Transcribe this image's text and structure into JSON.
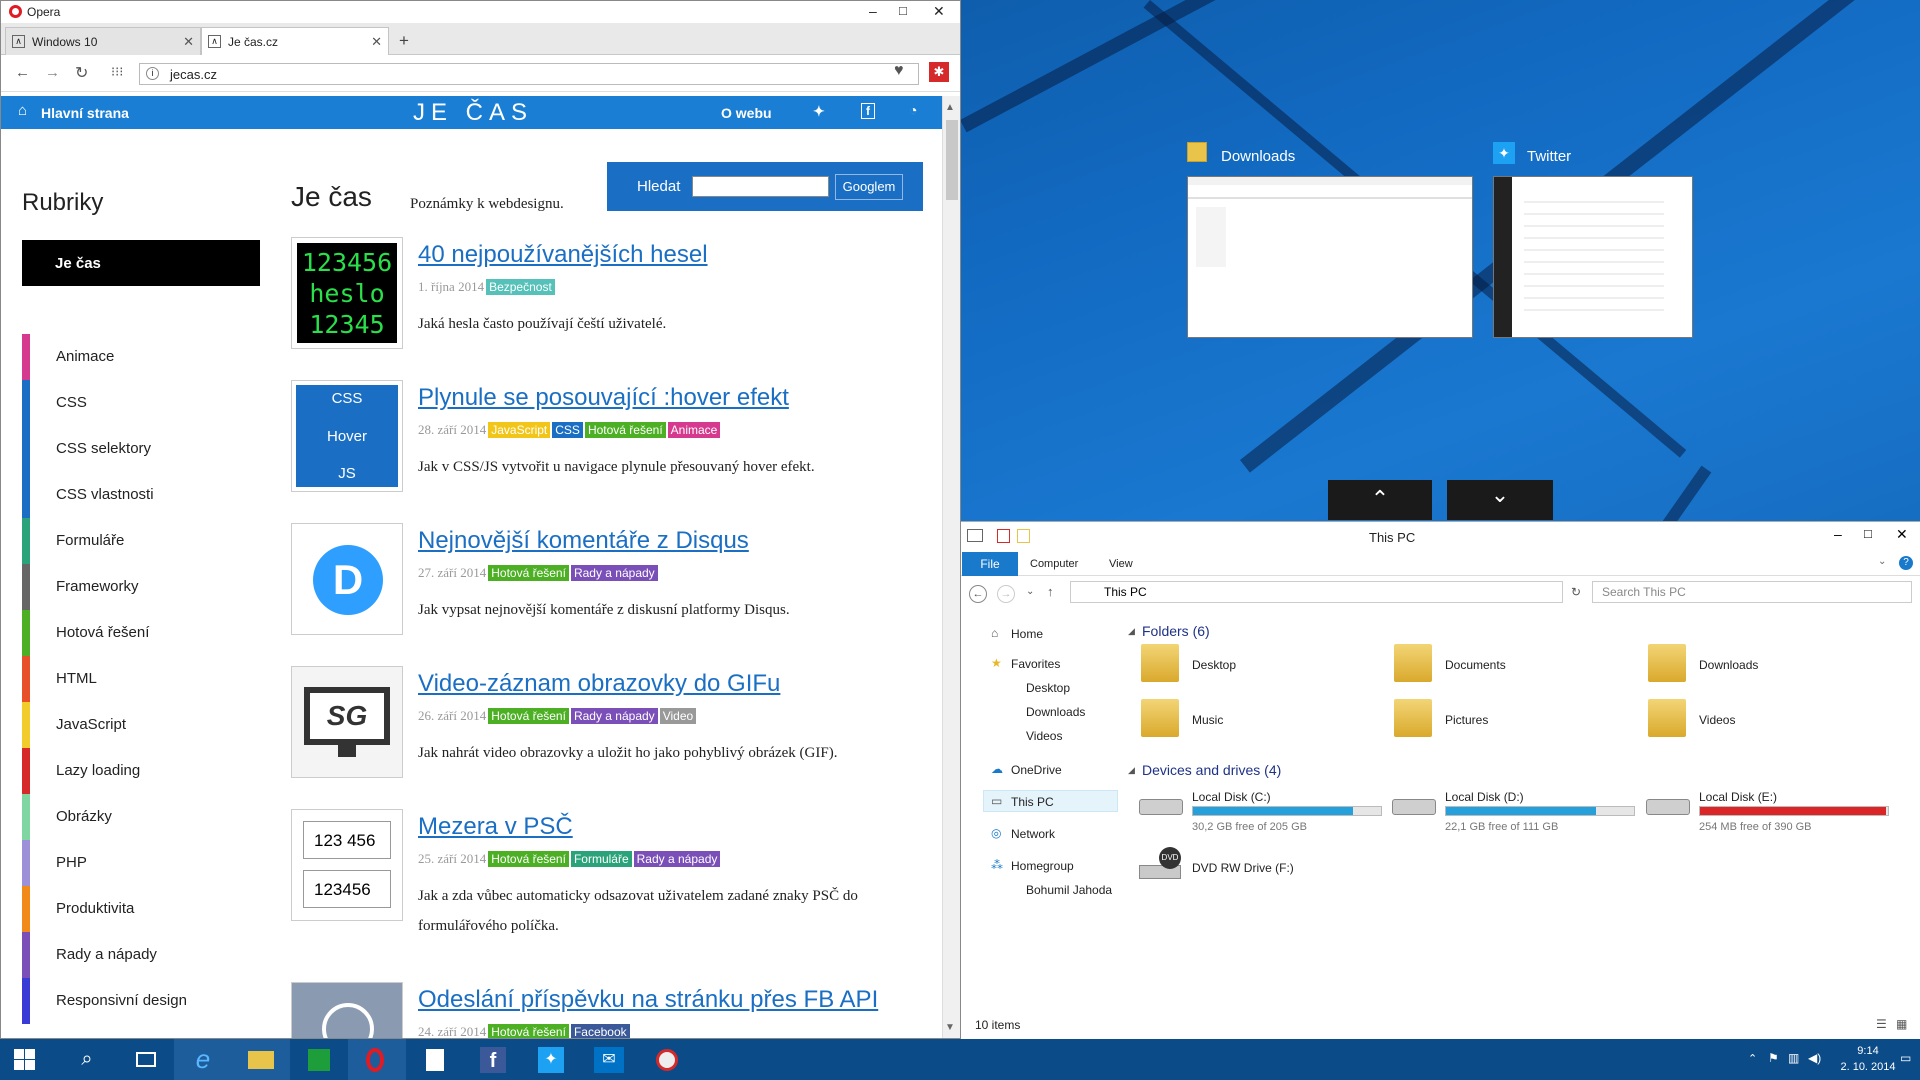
{
  "opera": {
    "title": "Opera",
    "tabs": [
      {
        "label": "Windows 10"
      },
      {
        "label": "Je čas.cz"
      }
    ],
    "url": "jecas.cz"
  },
  "site": {
    "nav_home": "Hlavní strana",
    "logo": "JE ČAS",
    "nav_about": "O webu",
    "heading": "Je čas",
    "tagline": "Poznámky k webdesignu.",
    "search_label": "Hledat",
    "search_button": "Googlem",
    "rubriky": "Rubriky",
    "active_cat": "Je čas",
    "categories": [
      {
        "label": "Animace",
        "color": "#d63a8f"
      },
      {
        "label": "CSS",
        "color": "#1a6fc4"
      },
      {
        "label": "CSS selektory",
        "color": "#1a6fc4"
      },
      {
        "label": "CSS vlastnosti",
        "color": "#1a6fc4"
      },
      {
        "label": "Formuláře",
        "color": "#2aa37a"
      },
      {
        "label": "Frameworky",
        "color": "#666666"
      },
      {
        "label": "Hotová řešení",
        "color": "#4caf24"
      },
      {
        "label": "HTML",
        "color": "#e8502a"
      },
      {
        "label": "JavaScript",
        "color": "#f2cc2a"
      },
      {
        "label": "Lazy loading",
        "color": "#d62a2a"
      },
      {
        "label": "Obrázky",
        "color": "#7fd6a0"
      },
      {
        "label": "PHP",
        "color": "#9c90d8"
      },
      {
        "label": "Produktivita",
        "color": "#f28a1a"
      },
      {
        "label": "Rady a nápady",
        "color": "#7a4fb8"
      },
      {
        "label": "Responsivní design",
        "color": "#3a3ad6"
      }
    ],
    "articles": [
      {
        "title": "40 nejpoužívanějších hesel",
        "date": "1. října 2014",
        "tags": [
          {
            "label": "Bezpečnost",
            "color": "#55c1b8"
          }
        ],
        "desc": "Jaká hesla často používají čeští uživatelé.",
        "thumb": {
          "lines": [
            "123456",
            "heslo",
            "12345"
          ]
        }
      },
      {
        "title": "Plynule se posouvající :hover efekt",
        "date": "28. září 2014",
        "tags": [
          {
            "label": "JavaScript",
            "color": "#f2c619"
          },
          {
            "label": "CSS",
            "color": "#1a6fc4"
          },
          {
            "label": "Hotová řešení",
            "color": "#4caf24"
          },
          {
            "label": "Animace",
            "color": "#d63a8f"
          }
        ],
        "desc": "Jak v CSS/JS vytvořit u navigace plynule přesouvaný hover efekt.",
        "thumb": {
          "lines": [
            "CSS",
            "Hover",
            "JS"
          ]
        }
      },
      {
        "title": "Nejnovější komentáře z Disqus",
        "date": "27. září 2014",
        "tags": [
          {
            "label": "Hotová řešení",
            "color": "#4caf24"
          },
          {
            "label": "Rady a nápady",
            "color": "#7a4fb8"
          }
        ],
        "desc": "Jak vypsat nejnovější komentáře z diskusní platformy Disqus.",
        "thumb": {
          "lines": [
            "D"
          ]
        }
      },
      {
        "title": "Video-záznam obrazovky do GIFu",
        "date": "26. září 2014",
        "tags": [
          {
            "label": "Hotová řešení",
            "color": "#4caf24"
          },
          {
            "label": "Rady a nápady",
            "color": "#7a4fb8"
          },
          {
            "label": "Video",
            "color": "#999999"
          }
        ],
        "desc": "Jak nahrát video obrazovky a uložit ho jako pohyblivý obrázek (GIF).",
        "thumb": {
          "lines": [
            "SG"
          ]
        }
      },
      {
        "title": "Mezera v PSČ",
        "date": "25. září 2014",
        "tags": [
          {
            "label": "Hotová řešení",
            "color": "#4caf24"
          },
          {
            "label": "Formuláře",
            "color": "#2aa37a"
          },
          {
            "label": "Rady a nápady",
            "color": "#7a4fb8"
          }
        ],
        "desc": "Jak a zda vůbec automaticky odsazovat uživatelem zadané znaky PSČ do formulářového políčka.",
        "thumb": {
          "lines": [
            "123 456",
            "123456"
          ]
        }
      },
      {
        "title": "Odeslání příspěvku na stránku přes FB API",
        "date": "24. září 2014",
        "tags": [
          {
            "label": "Hotová řešení",
            "color": "#4caf24"
          },
          {
            "label": "Facebook",
            "color": "#3b5998"
          }
        ],
        "desc": "",
        "thumb": {
          "lines": []
        }
      }
    ]
  },
  "taskview": {
    "windows": [
      {
        "label": "Downloads"
      },
      {
        "label": "Twitter"
      }
    ]
  },
  "explorer": {
    "title": "This PC",
    "ribbon_tabs": [
      "File",
      "Computer",
      "View"
    ],
    "address": "This PC",
    "search_placeholder": "Search This PC",
    "nav": {
      "home": "Home",
      "favorites": "Favorites",
      "desktop": "Desktop",
      "downloads": "Downloads",
      "videos": "Videos",
      "onedrive": "OneDrive",
      "thispc": "This PC",
      "network": "Network",
      "homegroup": "Homegroup",
      "user": "Bohumil Jahoda"
    },
    "folders_header": "Folders (6)",
    "folders": [
      "Desktop",
      "Documents",
      "Downloads",
      "Music",
      "Pictures",
      "Videos"
    ],
    "drives_header": "Devices and drives (4)",
    "drives": [
      {
        "name": "Local Disk (C:)",
        "free": "30,2 GB free of 205 GB",
        "used": 0.85,
        "color": "#26a0da"
      },
      {
        "name": "Local Disk (D:)",
        "free": "22,1 GB free of 111 GB",
        "used": 0.8,
        "color": "#26a0da"
      },
      {
        "name": "Local Disk (E:)",
        "free": "254 MB free of 390 GB",
        "used": 0.99,
        "color": "#da2626"
      }
    ],
    "dvd": "DVD RW Drive (F:)",
    "status": "10 items"
  },
  "taskbar": {
    "time": "9:14",
    "date": "2. 10. 2014"
  }
}
